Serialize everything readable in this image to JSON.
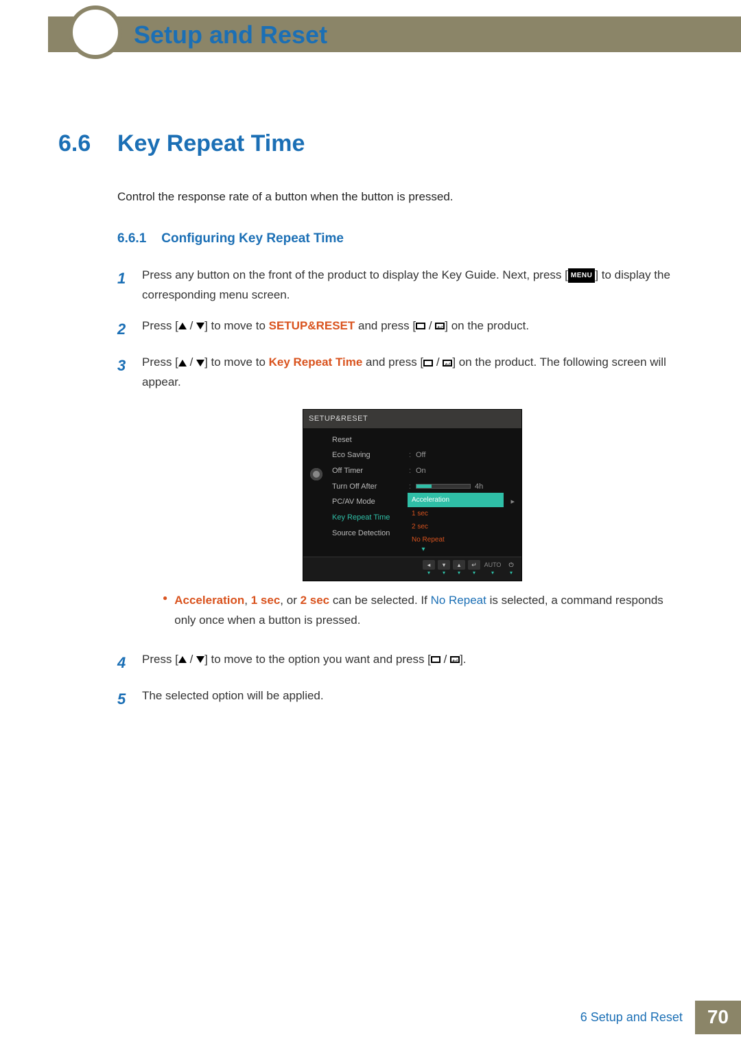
{
  "header": {
    "title": "Setup and Reset"
  },
  "section": {
    "number": "6.6",
    "title": "Key Repeat Time"
  },
  "intro": "Control the response rate of a button when the button is pressed.",
  "subsection": {
    "number": "6.6.1",
    "title": "Configuring Key Repeat Time"
  },
  "steps": {
    "s1": {
      "num": "1",
      "pre": "Press any button on the front of the product to display the Key Guide. Next, press [",
      "menu": "MENU",
      "post": "] to display the corresponding menu screen."
    },
    "s2": {
      "num": "2",
      "pre": "Press [",
      "mid1": "] to move to ",
      "target": "SETUP&RESET",
      "mid2": " and press [",
      "post": "] on the product."
    },
    "s3": {
      "num": "3",
      "pre": "Press [",
      "mid1": "] to move to ",
      "target": "Key Repeat Time",
      "mid2": " and press [",
      "post": "] on the product. The following screen will appear."
    },
    "s4": {
      "num": "4",
      "pre": "Press [",
      "mid": "] to move to the option you want and press [",
      "post": "]."
    },
    "s5": {
      "num": "5",
      "text": "The selected option will be applied."
    }
  },
  "note": {
    "a": "Acceleration",
    "sep1": ", ",
    "b": "1 sec",
    "sep2": ", or ",
    "c": "2 sec",
    "mid": " can be selected. If ",
    "d": "No Repeat",
    "post": " is selected, a command responds only once when a button is pressed."
  },
  "osd": {
    "title": "SETUP&RESET",
    "rows": {
      "reset": "Reset",
      "eco": "Eco Saving",
      "eco_val": "Off",
      "timer": "Off Timer",
      "timer_val": "On",
      "after": "Turn Off After",
      "after_val": "4h",
      "pcav": "PC/AV Mode",
      "krt": "Key Repeat Time",
      "src": "Source Detection"
    },
    "popup": {
      "sel": "Acceleration",
      "o1": "1 sec",
      "o2": "2 sec",
      "o3": "No Repeat"
    },
    "footer": {
      "auto": "AUTO"
    }
  },
  "footer": {
    "chapter": "6 Setup and Reset",
    "page": "70"
  }
}
